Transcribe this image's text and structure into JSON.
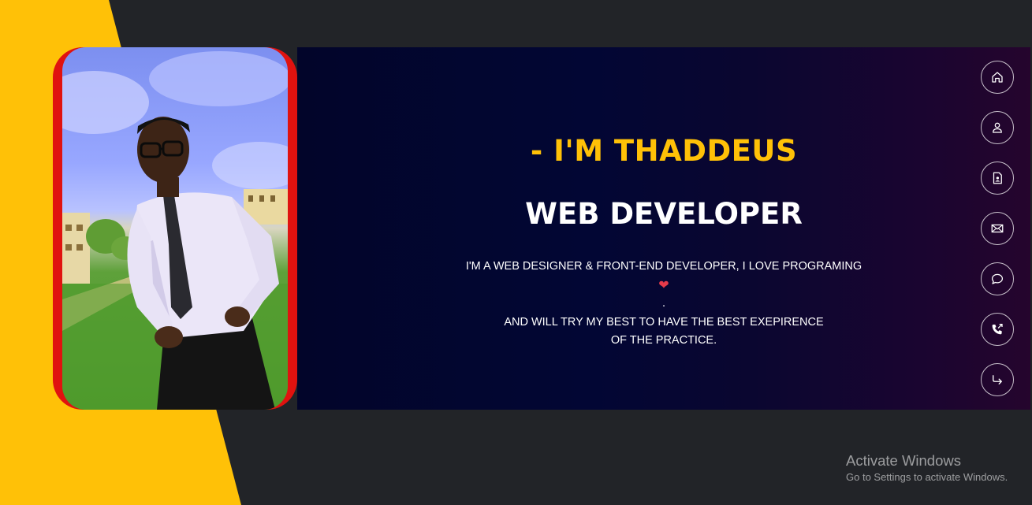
{
  "profile": {
    "intro": "- I'M THADDEUS",
    "role": "WEB DEVELOPER",
    "bio_line1": "I'M A WEB DESIGNER & FRONT-END DEVELOPER, I LOVE PROGRAMING",
    "bio_line1_end": ".",
    "bio_line2": "AND WILL TRY MY BEST TO HAVE THE BEST EXEPIRENCE",
    "bio_line3": "OF THE PRACTICE.",
    "heart_glyph": "❤"
  },
  "photo": {
    "subject": "portrait-photo",
    "frame_color": "#e0120f"
  },
  "nav": {
    "items": [
      {
        "icon": "home-icon"
      },
      {
        "icon": "person-icon"
      },
      {
        "icon": "resume-icon"
      },
      {
        "icon": "envelope-icon"
      },
      {
        "icon": "chat-icon"
      },
      {
        "icon": "phone-outgoing-icon"
      },
      {
        "icon": "logout-arrow-icon"
      }
    ]
  },
  "system": {
    "activate_title": "Activate Windows",
    "activate_sub": "Go to Settings to activate Windows."
  },
  "colors": {
    "accent": "#ffc107",
    "background": "#222428",
    "hero_start": "#02052a",
    "hero_end": "#25052d",
    "heart": "#e63b4a"
  }
}
